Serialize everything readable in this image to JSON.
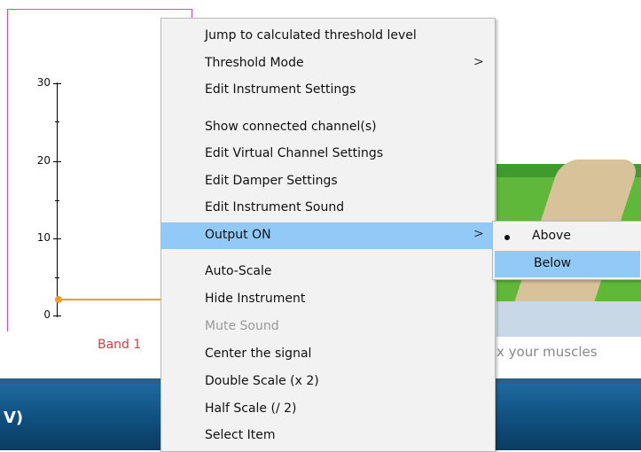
{
  "chart": {
    "tick_labels": [
      "30",
      "20",
      "10",
      "0"
    ],
    "band_label": "Band 1"
  },
  "scene": {
    "caption": "x your muscles"
  },
  "bottom_bar": {
    "label": "V)"
  },
  "context_menu": {
    "items": [
      {
        "label": "Jump to calculated threshold level"
      },
      {
        "label": "Threshold Mode",
        "arrow": ">"
      },
      {
        "label": "Edit Instrument Settings"
      },
      {
        "label": "Show connected channel(s)"
      },
      {
        "label": "Edit Virtual Channel Settings"
      },
      {
        "label": "Edit Damper Settings"
      },
      {
        "label": "Edit Instrument Sound"
      },
      {
        "label": "Output ON",
        "arrow": ">"
      },
      {
        "label": "Auto-Scale"
      },
      {
        "label": "Hide Instrument"
      },
      {
        "label": "Mute Sound"
      },
      {
        "label": "Center the signal"
      },
      {
        "label": "Double Scale (x 2)"
      },
      {
        "label": "Half Scale (/ 2)"
      },
      {
        "label": "Select Item"
      }
    ]
  },
  "submenu": {
    "items": [
      {
        "label": "Above",
        "selected": true
      },
      {
        "label": "Below"
      }
    ]
  },
  "colors": {
    "highlight": "#91c9f7",
    "panel_border": "#e040e0",
    "band_line": "#f39a2c",
    "band_label": "#d04040",
    "bottom_bar": "#0f4f7e"
  }
}
